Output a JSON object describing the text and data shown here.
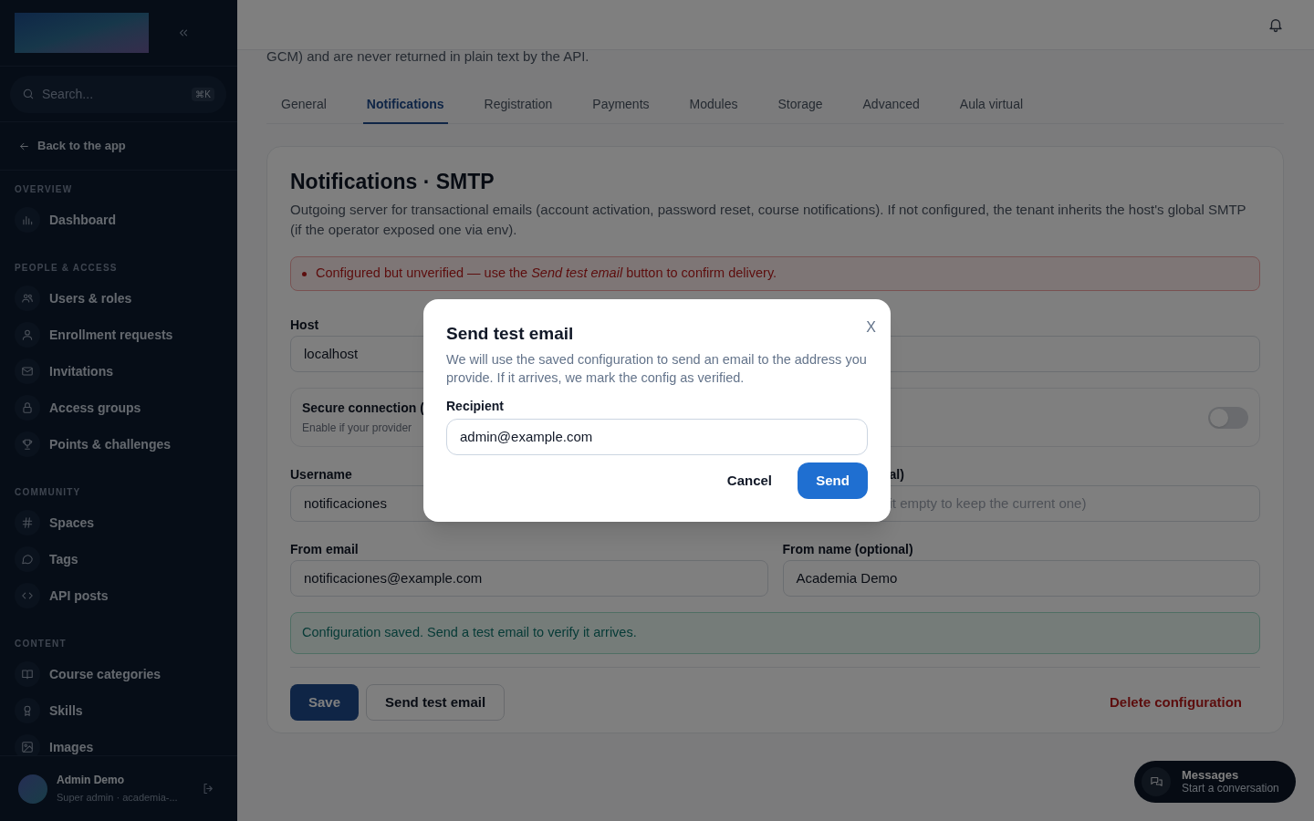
{
  "sidebar": {
    "search": {
      "placeholder": "Search...",
      "shortcut": "⌘K"
    },
    "back_link": "Back to the app",
    "sections": [
      {
        "title": "OVERVIEW",
        "items": [
          {
            "label": "Dashboard"
          }
        ]
      },
      {
        "title": "PEOPLE & ACCESS",
        "items": [
          {
            "label": "Users & roles"
          },
          {
            "label": "Enrollment requests"
          },
          {
            "label": "Invitations"
          },
          {
            "label": "Access groups"
          },
          {
            "label": "Points & challenges"
          }
        ]
      },
      {
        "title": "COMMUNITY",
        "items": [
          {
            "label": "Spaces"
          },
          {
            "label": "Tags"
          },
          {
            "label": "API posts"
          }
        ]
      },
      {
        "title": "CONTENT",
        "items": [
          {
            "label": "Course categories"
          },
          {
            "label": "Skills"
          },
          {
            "label": "Images"
          }
        ]
      }
    ],
    "user": {
      "name": "Admin Demo",
      "subtitle": "Super admin · academia-..."
    }
  },
  "intro_text": "GCM) and are never returned in plain text by the API.",
  "tabs": [
    {
      "label": "General",
      "selected": false
    },
    {
      "label": "Notifications",
      "selected": true
    },
    {
      "label": "Registration",
      "selected": false
    },
    {
      "label": "Payments",
      "selected": false
    },
    {
      "label": "Modules",
      "selected": false
    },
    {
      "label": "Storage",
      "selected": false
    },
    {
      "label": "Advanced",
      "selected": false
    },
    {
      "label": "Aula virtual",
      "selected": false
    }
  ],
  "card": {
    "title": "Notifications · SMTP",
    "description": "Outgoing server for transactional emails (account activation, password reset, course notifications). If not configured, the tenant inherits the host's global SMTP (if the operator exposed one via env).",
    "alert": "Configured but unverified — use the *Send test email* button to confirm delivery.",
    "host": {
      "label": "Host",
      "value": "localhost"
    },
    "secure": {
      "label": "Secure connection (",
      "hint": "Enable if your provider",
      "on": false
    },
    "username": {
      "label": "Username",
      "value": "notificaciones"
    },
    "password": {
      "label": "al)",
      "placeholder": "it empty to keep the current one)"
    },
    "from_email": {
      "label": "From email",
      "value": "notificaciones@example.com"
    },
    "from_name": {
      "label": "From name (optional)",
      "value": "Academia Demo"
    },
    "success": "Configuration saved. Send a test email to verify it arrives.",
    "buttons": {
      "save": "Save",
      "send_test": "Send test email",
      "delete": "Delete configuration"
    }
  },
  "modal": {
    "title": "Send test email",
    "close": "X",
    "description": "We will use the saved configuration to send an email to the address you provide. If it arrives, we mark the config as verified.",
    "recipient_label": "Recipient",
    "recipient_value": "admin@example.com",
    "cancel": "Cancel",
    "send": "Send"
  },
  "chat": {
    "title": "Messages",
    "subtitle": "Start a conversation"
  }
}
